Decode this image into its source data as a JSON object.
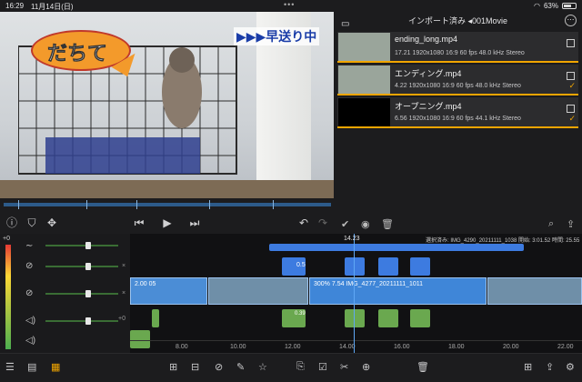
{
  "status": {
    "time": "16:29",
    "date": "11月14日(日)",
    "battery": "63%",
    "battery_level": 0.63
  },
  "preview": {
    "speech_bubble": "だちて",
    "ff_overlay": "▶▶▶早送り中"
  },
  "import_panel": {
    "title": "インポート済み ◂001Movie",
    "clips": [
      {
        "name": "ending_long.mp4",
        "meta": "17.21  1920x1080  16:9  60 fps  48.0 kHz  Stereo",
        "checked": false
      },
      {
        "name": "エンディング.mp4",
        "meta": "4.22  1920x1080  16:9  60 fps  48.0 kHz  Stereo",
        "checked": true
      },
      {
        "name": "オープニング.mp4",
        "meta": "6.56  1920x1080  16:9  60 fps  44.1 kHz  Stereo",
        "checked": true
      }
    ]
  },
  "timeline": {
    "playhead_time": "14.23",
    "selection_info": "選択済み: IMG_4290_20211111_1038 開始: 3:01.52 時間: 25.55",
    "ruler": [
      "8.00",
      "10.00",
      "12.00",
      "14.00",
      "16.00",
      "18.00",
      "20.00",
      "22.00"
    ],
    "mixer_top": "+0",
    "mixer_mid": "+0",
    "clip_labels": [
      "2.00",
      "0.5",
      "300%",
      "7.54",
      "IMG_4277_20211111_1011",
      "0.39",
      "0.5"
    ],
    "title_clip_text": "2.00  05"
  },
  "colors": {
    "accent": "#f0a500",
    "timeline_blue": "#3d7be0",
    "audio_green": "#6aa84f"
  }
}
